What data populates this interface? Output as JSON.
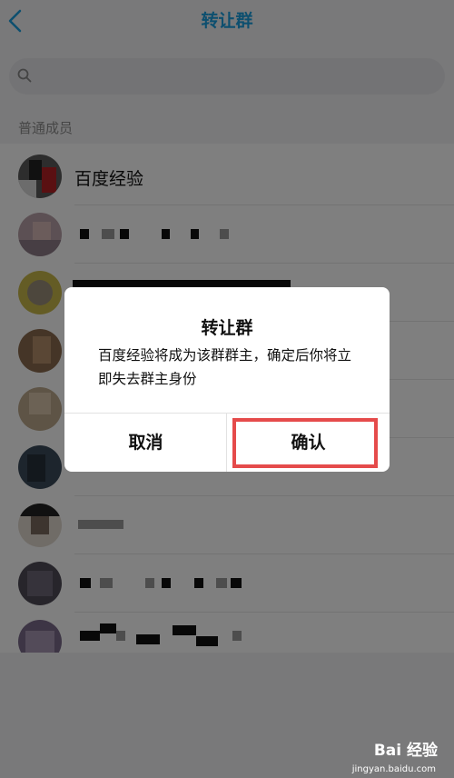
{
  "header": {
    "title": "转让群",
    "back_icon": "chevron-left-icon"
  },
  "search": {
    "placeholder": "",
    "icon": "search-icon"
  },
  "section": {
    "label": "普通成员"
  },
  "members": [
    {
      "name": "百度经验"
    },
    {
      "name": ""
    },
    {
      "name": ""
    },
    {
      "name": ""
    },
    {
      "name": ""
    },
    {
      "name": ""
    },
    {
      "name": ""
    },
    {
      "name": ""
    },
    {
      "name": ""
    }
  ],
  "dialog": {
    "title": "转让群",
    "message": "百度经验将成为该群群主，确定后你将立即失去群主身份",
    "cancel_label": "取消",
    "confirm_label": "确认"
  },
  "watermark": {
    "brand": "Bai 经验",
    "url": "jingyan.baidu.com"
  },
  "colors": {
    "accent": "#1a9fde",
    "highlight": "#e54b4b",
    "overlay": "rgba(0,0,0,0.5)"
  }
}
